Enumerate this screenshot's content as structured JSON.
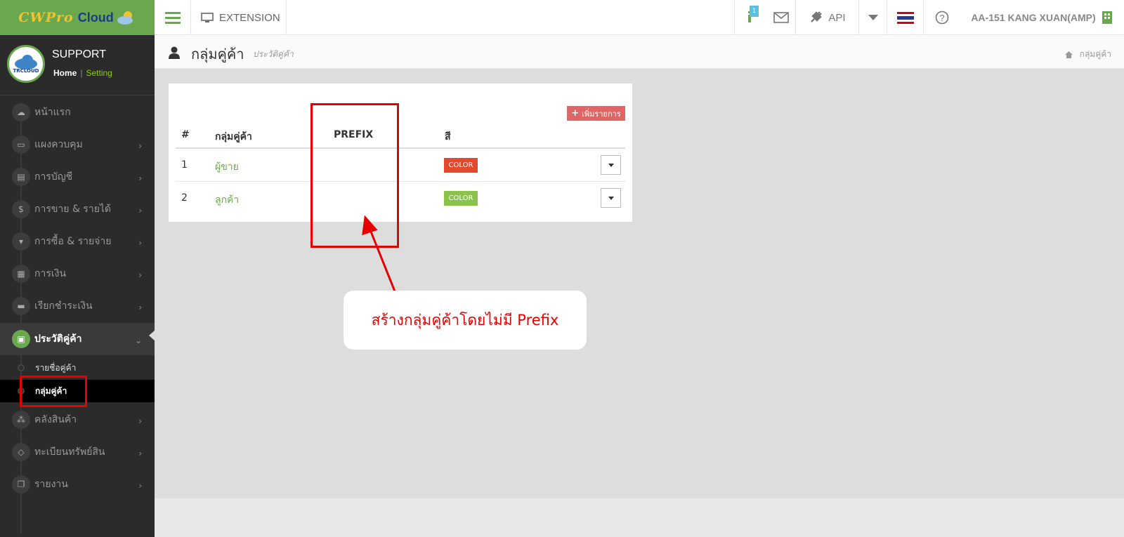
{
  "app": {
    "logo_part1": "CWPro",
    "logo_part2": "Cloud",
    "extension_label": "EXTENSION",
    "notification_count": "1",
    "api_label": "API",
    "user_label": "AA-151 KANG XUAN(AMP)"
  },
  "profile": {
    "avatar_text": "TRCLOUD",
    "name": "SUPPORT",
    "home_link": "Home",
    "separator": "|",
    "setting_link": "Setting"
  },
  "sidebar": {
    "items": [
      {
        "label": "หน้าแรก",
        "icon": "cloud-icon"
      },
      {
        "label": "แผงควบคุม",
        "icon": "monitor-icon"
      },
      {
        "label": "การบัญชี",
        "icon": "book-icon"
      },
      {
        "label": "การขาย & รายได้",
        "icon": "dollar-icon"
      },
      {
        "label": "การซื้อ & รายจ่าย",
        "icon": "cart-icon"
      },
      {
        "label": "การเงิน",
        "icon": "calendar-icon"
      },
      {
        "label": "เรียกชำระเงิน",
        "icon": "credit-card-icon"
      },
      {
        "label": "ประวัติคู่ค้า",
        "icon": "contact-book-icon"
      },
      {
        "label": "คลังสินค้า",
        "icon": "cubes-icon"
      },
      {
        "label": "ทะเบียนทรัพย์สิน",
        "icon": "diamond-icon"
      },
      {
        "label": "รายงาน",
        "icon": "copy-icon"
      }
    ],
    "subitems": [
      {
        "label": "รายชื่อคู่ค้า"
      },
      {
        "label": "กลุ่มคู่ค้า"
      }
    ]
  },
  "page": {
    "title": "กลุ่มคู่ค้า",
    "subtitle": "ประวัติคู่ค้า",
    "breadcrumb": "กลุ่มคู่ค้า"
  },
  "table": {
    "add_button": "เพิ่มรายการ",
    "headers": {
      "num": "#",
      "group": "กลุ่มคู่ค้า",
      "prefix": "PREFIX",
      "color": "สี"
    },
    "rows": [
      {
        "num": "1",
        "name": "ผู้ขาย",
        "prefix": "",
        "color_label": "COLOR",
        "color": "#e2492d"
      },
      {
        "num": "2",
        "name": "ลูกค้า",
        "prefix": "",
        "color_label": "COLOR",
        "color": "#8bc34a"
      }
    ]
  },
  "annotation": {
    "callout_text": "สร้างกลุ่มคู่ค้าโดยไม่มี Prefix"
  },
  "colors": {
    "accent_green": "#6aa84f",
    "sidebar_bg": "#2b2b2b",
    "annotation_red": "#e60000",
    "add_button_red": "#e06666"
  }
}
